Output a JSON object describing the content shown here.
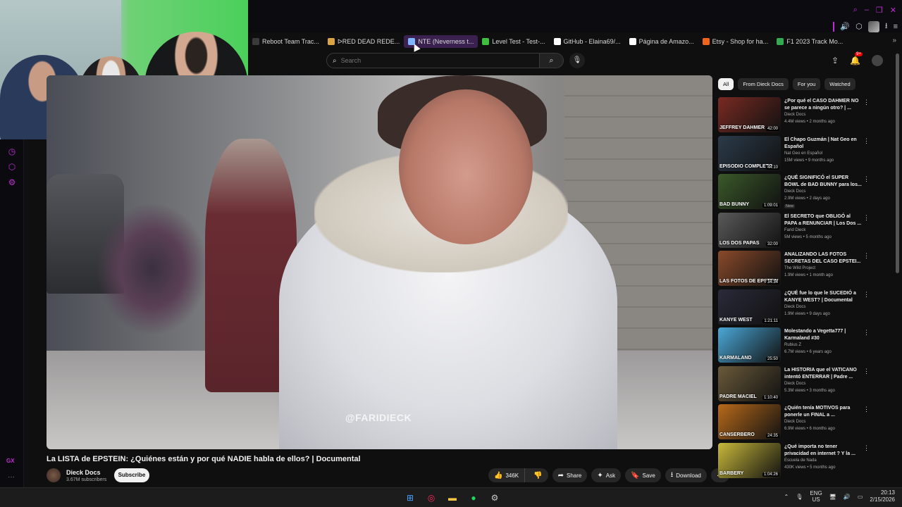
{
  "bookmarks": [
    {
      "label": "Reboot Team Trac...",
      "icon": "bookmark-icon",
      "color": "#3a3a3a"
    },
    {
      "label": "ᐅRED DEAD REDE...",
      "icon": "game-icon",
      "color": "#d9a441"
    },
    {
      "label": "NTE (Neverness t...",
      "icon": "page-icon",
      "color": "#7fb4ff",
      "active": true
    },
    {
      "label": "Level Test - Test-...",
      "icon": "check-icon",
      "color": "#3fbf3f"
    },
    {
      "label": "GitHub - Elaina69/...",
      "icon": "github-icon",
      "color": "#ffffff"
    },
    {
      "label": "Página de Amazo...",
      "icon": "amazon-icon",
      "color": "#ffffff"
    },
    {
      "label": "Etsy - Shop for ha...",
      "icon": "etsy-icon",
      "color": "#f1641e"
    },
    {
      "label": "F1 2023 Track Mo...",
      "icon": "drive-icon",
      "color": "#34a853"
    }
  ],
  "search": {
    "placeholder": "Search"
  },
  "notifications": {
    "badge": "9+"
  },
  "video": {
    "title": "La LISTA de EPSTEIN: ¿Quiénes están y por qué NADIE habla de ellos? | Documental",
    "watermark": "@FARIDIECK",
    "channel": "Dieck Docs",
    "subscribers": "3.67M subscribers",
    "subscribe_label": "Subscribe",
    "likes": "346K",
    "share_label": "Share",
    "ask_label": "Ask",
    "save_label": "Save",
    "download_label": "Download"
  },
  "chips": [
    "All",
    "From Dieck Docs",
    "For you",
    "Watched"
  ],
  "recommendations": [
    {
      "title": "¿Por qué el CASO DAHMER NO se parece a ningún otro? | ...",
      "channel": "Dieck Docs",
      "meta": "4.4M views • 2 months ago",
      "duration": "42:00",
      "caption": "JEFFREY DAHMER",
      "color": "#7a2a22"
    },
    {
      "title": "El Chapo Guzmán | Nat Geo en Español",
      "channel": "Nat Geo en Español",
      "meta": "15M views • 9 months ago",
      "duration": "44:10",
      "caption": "EPISODIO COMPLETO",
      "color": "#2b3b4a"
    },
    {
      "title": "¿QUÉ SIGNIFICÓ el SUPER BOWL de BAD BUNNY para los...",
      "channel": "Dieck Docs",
      "meta": "2.9M views • 2 days ago",
      "duration": "1:09:01",
      "caption": "BAD BUNNY",
      "color": "#3a5a2a",
      "new": "New"
    },
    {
      "title": "El SECRETO que OBLIGÓ al PAPA a RENUNCIAR | Los Dos ...",
      "channel": "Farid Dieck",
      "meta": "5M views • 5 months ago",
      "duration": "32:00",
      "caption": "LOS DOS PAPAS",
      "color": "#5a5a5a"
    },
    {
      "title": "ANALIZANDO LAS FOTOS SECRETAS DEL CASO EPSTEI...",
      "channel": "The Wild Project",
      "meta": "1.9M views • 1 month ago",
      "duration": "34:34",
      "caption": "LAS FOTOS DE EPSTEIN",
      "color": "#8a4a2a"
    },
    {
      "title": "¿QUÉ fue lo que le SUCEDIÓ a KANYE WEST? | Documental",
      "channel": "Dieck Docs",
      "meta": "1.9M views • 9 days ago",
      "duration": "1:21:11",
      "caption": "KANYE WEST",
      "color": "#2a2a3a"
    },
    {
      "title": "Molestando a Vegetta777 | Karmaland #30",
      "channel": "Rubius Z",
      "meta": "6.7M views • 6 years ago",
      "duration": "25:50",
      "caption": "KARMALAND",
      "color": "#4aa8d8"
    },
    {
      "title": "La HISTORIA que el VATICANO intentó ENTERRAR | Padre ...",
      "channel": "Dieck Docs",
      "meta": "5.3M views • 3 months ago",
      "duration": "1:10:40",
      "caption": "PADRE MACIEL",
      "color": "#6a5a3a"
    },
    {
      "title": "¿Quién tenía MOTIVOS para ponerle un FINAL a ...",
      "channel": "Dieck Docs",
      "meta": "6.9M views • 6 months ago",
      "duration": "24:35",
      "caption": "CANSERBERO",
      "color": "#b86a1a"
    },
    {
      "title": "¿Qué importa no tener privacidad en internet ? Y la ...",
      "channel": "Escuela de Nada",
      "meta": "430K views • 5 months ago",
      "duration": "1:04:26",
      "caption": "BARBERY",
      "color": "#c8b83a"
    }
  ],
  "taskbar": {
    "lang_top": "ENG",
    "lang_bottom": "US",
    "time": "20:13",
    "date": "2/15/2026"
  },
  "rail": {
    "gx_label": "GX"
  }
}
